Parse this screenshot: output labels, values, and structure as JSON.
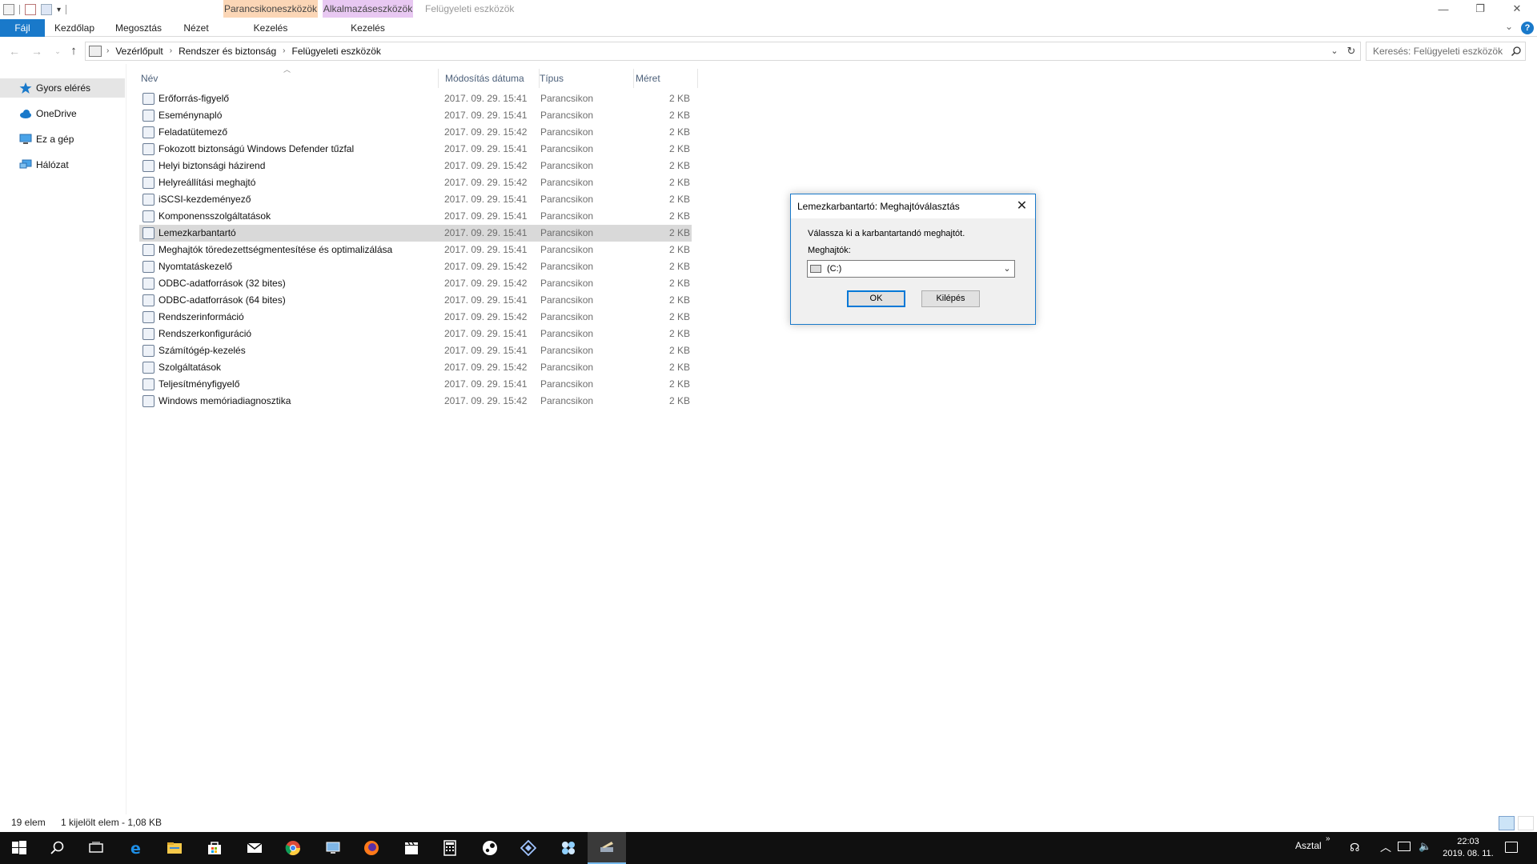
{
  "window": {
    "title": "Felügyeleti eszközök",
    "context_tab_shortcut": "Parancsikoneszközök",
    "context_tab_app": "Alkalmazáseszközök",
    "min_glyph": "—",
    "max_glyph": "❐",
    "close_glyph": "✕"
  },
  "ribbon": {
    "tabs": [
      "Fájl",
      "Kezdőlap",
      "Megosztás",
      "Nézet",
      "Kezelés",
      "Kezelés"
    ],
    "accent": "#1979ca",
    "context_shortcut_color": "#fbd6b6",
    "context_app_color": "#e8c8f2",
    "help_glyph": "?",
    "chevron_glyph": "⌄"
  },
  "address": {
    "crumbs": [
      "Vezérlőpult",
      "Rendszer és biztonság",
      "Felügyeleti eszközök"
    ],
    "search_placeholder": "Keresés: Felügyeleti eszközök"
  },
  "sidebar": {
    "items": [
      {
        "label": "Gyors elérés",
        "icon": "star-icon",
        "selected": true
      },
      {
        "label": "OneDrive",
        "icon": "cloud-icon",
        "selected": false
      },
      {
        "label": "Ez a gép",
        "icon": "computer-icon",
        "selected": false
      },
      {
        "label": "Hálózat",
        "icon": "network-icon",
        "selected": false
      }
    ]
  },
  "columns": {
    "name": "Név",
    "date": "Módosítás dátuma",
    "type": "Típus",
    "size": "Méret"
  },
  "files": [
    {
      "name": "Erőforrás-figyelő",
      "date": "2017. 09. 29. 15:41",
      "type": "Parancsikon",
      "size": "2 KB"
    },
    {
      "name": "Eseménynapló",
      "date": "2017. 09. 29. 15:41",
      "type": "Parancsikon",
      "size": "2 KB"
    },
    {
      "name": "Feladatütemező",
      "date": "2017. 09. 29. 15:42",
      "type": "Parancsikon",
      "size": "2 KB"
    },
    {
      "name": "Fokozott biztonságú Windows Defender tűzfal",
      "date": "2017. 09. 29. 15:41",
      "type": "Parancsikon",
      "size": "2 KB"
    },
    {
      "name": "Helyi biztonsági házirend",
      "date": "2017. 09. 29. 15:42",
      "type": "Parancsikon",
      "size": "2 KB"
    },
    {
      "name": "Helyreállítási meghajtó",
      "date": "2017. 09. 29. 15:42",
      "type": "Parancsikon",
      "size": "2 KB"
    },
    {
      "name": "iSCSI-kezdeményező",
      "date": "2017. 09. 29. 15:41",
      "type": "Parancsikon",
      "size": "2 KB"
    },
    {
      "name": "Komponensszolgáltatások",
      "date": "2017. 09. 29. 15:41",
      "type": "Parancsikon",
      "size": "2 KB"
    },
    {
      "name": "Lemezkarbantartó",
      "date": "2017. 09. 29. 15:41",
      "type": "Parancsikon",
      "size": "2 KB",
      "selected": true
    },
    {
      "name": "Meghajtók töredezettségmentesítése és optimalizálása",
      "date": "2017. 09. 29. 15:41",
      "type": "Parancsikon",
      "size": "2 KB"
    },
    {
      "name": "Nyomtatáskezelő",
      "date": "2017. 09. 29. 15:42",
      "type": "Parancsikon",
      "size": "2 KB"
    },
    {
      "name": "ODBC-adatforrások (32 bites)",
      "date": "2017. 09. 29. 15:42",
      "type": "Parancsikon",
      "size": "2 KB"
    },
    {
      "name": "ODBC-adatforrások (64 bites)",
      "date": "2017. 09. 29. 15:41",
      "type": "Parancsikon",
      "size": "2 KB"
    },
    {
      "name": "Rendszerinformáció",
      "date": "2017. 09. 29. 15:42",
      "type": "Parancsikon",
      "size": "2 KB"
    },
    {
      "name": "Rendszerkonfiguráció",
      "date": "2017. 09. 29. 15:41",
      "type": "Parancsikon",
      "size": "2 KB"
    },
    {
      "name": "Számítógép-kezelés",
      "date": "2017. 09. 29. 15:41",
      "type": "Parancsikon",
      "size": "2 KB"
    },
    {
      "name": "Szolgáltatások",
      "date": "2017. 09. 29. 15:42",
      "type": "Parancsikon",
      "size": "2 KB"
    },
    {
      "name": "Teljesítményfigyelő",
      "date": "2017. 09. 29. 15:41",
      "type": "Parancsikon",
      "size": "2 KB"
    },
    {
      "name": "Windows memóriadiagnosztika",
      "date": "2017. 09. 29. 15:42",
      "type": "Parancsikon",
      "size": "2 KB"
    }
  ],
  "status": {
    "count": "19 elem",
    "selection": "1 kijelölt elem - 1,08 KB"
  },
  "dialog": {
    "title": "Lemezkarbantartó: Meghajtóválasztás",
    "message": "Válassza ki a karbantartandó meghajtót.",
    "drives_label": "Meghajtók:",
    "selected_drive": "(C:)",
    "ok_label": "OK",
    "cancel_label": "Kilépés"
  },
  "taskbar": {
    "apps": [
      {
        "icon": "start-icon",
        "color": "#ffffff"
      },
      {
        "icon": "search-icon",
        "color": "#ffffff"
      },
      {
        "icon": "task-view-icon",
        "color": "#ffffff"
      },
      {
        "icon": "edge-icon",
        "color": "#1e8fe8"
      },
      {
        "icon": "file-explorer-icon",
        "color": "#f6c94a"
      },
      {
        "icon": "store-icon",
        "color": "#ffffff"
      },
      {
        "icon": "mail-icon",
        "color": "#ffffff"
      },
      {
        "icon": "chrome-icon",
        "color": "#dd4b39"
      },
      {
        "icon": "computer-icon",
        "color": "#7fb6e6"
      },
      {
        "icon": "firefox-icon",
        "color": "#ff7a1a"
      },
      {
        "icon": "clapper-icon",
        "color": "#ffffff"
      },
      {
        "icon": "calculator-icon",
        "color": "#ffffff"
      },
      {
        "icon": "steam-icon",
        "color": "#ffffff"
      },
      {
        "icon": "diamond-app-icon",
        "color": "#a0c4ff"
      },
      {
        "icon": "puzzle-app-icon",
        "color": "#cfe8ff"
      },
      {
        "icon": "disk-cleanup-icon",
        "color": "#e8d6a8",
        "active": true
      }
    ],
    "desktop_label": "Asztal",
    "time": "22:03",
    "date": "2019. 08. 11."
  }
}
